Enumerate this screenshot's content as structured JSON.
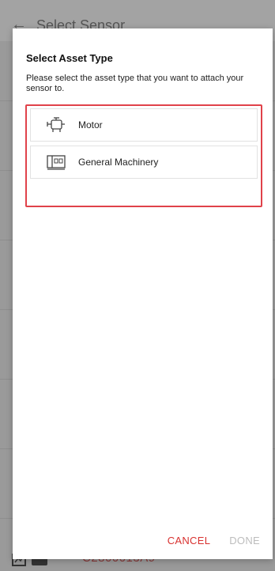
{
  "background": {
    "title": "Select Sensor",
    "bottom_text": "C2800013A9"
  },
  "dialog": {
    "title": "Select Asset Type",
    "description": "Please select the asset type that you want to attach your sensor to.",
    "options": [
      {
        "label": "Motor",
        "icon": "motor-icon"
      },
      {
        "label": "General Machinery",
        "icon": "machinery-icon"
      }
    ],
    "cancel_label": "CANCEL",
    "done_label": "DONE"
  },
  "colors": {
    "accent": "#d8312f",
    "highlight_border": "#e0424a",
    "disabled": "#bdbdbd"
  }
}
